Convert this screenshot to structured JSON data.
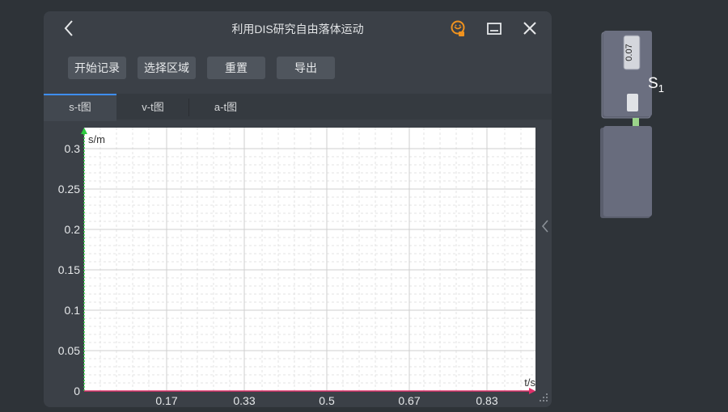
{
  "window": {
    "title": "利用DIS研究自由落体运动"
  },
  "toolbar": {
    "start_label": "开始记录",
    "select_label": "选择区域",
    "reset_label": "重置",
    "export_label": "导出"
  },
  "tabs": [
    {
      "label": "s-t图",
      "active": true
    },
    {
      "label": "v-t图",
      "active": false
    },
    {
      "label": "a-t图",
      "active": false
    }
  ],
  "icons": {
    "back": "chevron-left-icon",
    "skin": "orange-badge-icon",
    "minimize": "minimize-icon",
    "close": "close-icon",
    "collapse": "chevron-left-icon"
  },
  "chart_data": {
    "type": "line",
    "xlabel": "t/s",
    "ylabel": "s/m",
    "xlim": [
      0,
      1.0
    ],
    "ylim": [
      0,
      0.3
    ],
    "xticks": [
      "0.17",
      "0.33",
      "0.5",
      "0.67",
      "0.83"
    ],
    "yticks": [
      "0",
      "0.05",
      "0.1",
      "0.15",
      "0.2",
      "0.25",
      "0.3"
    ],
    "grid": true,
    "series": []
  },
  "device": {
    "display_value": "0.07",
    "label": "S",
    "label_sub": "1"
  },
  "colors": {
    "background": "#2e3338",
    "panel": "#3b4047",
    "plot_area": "#ffffff",
    "tab_accent": "#3e8ef7",
    "y_axis": "#2ecc40",
    "x_axis": "#e0306a",
    "skin_icon": "#f0921e"
  }
}
